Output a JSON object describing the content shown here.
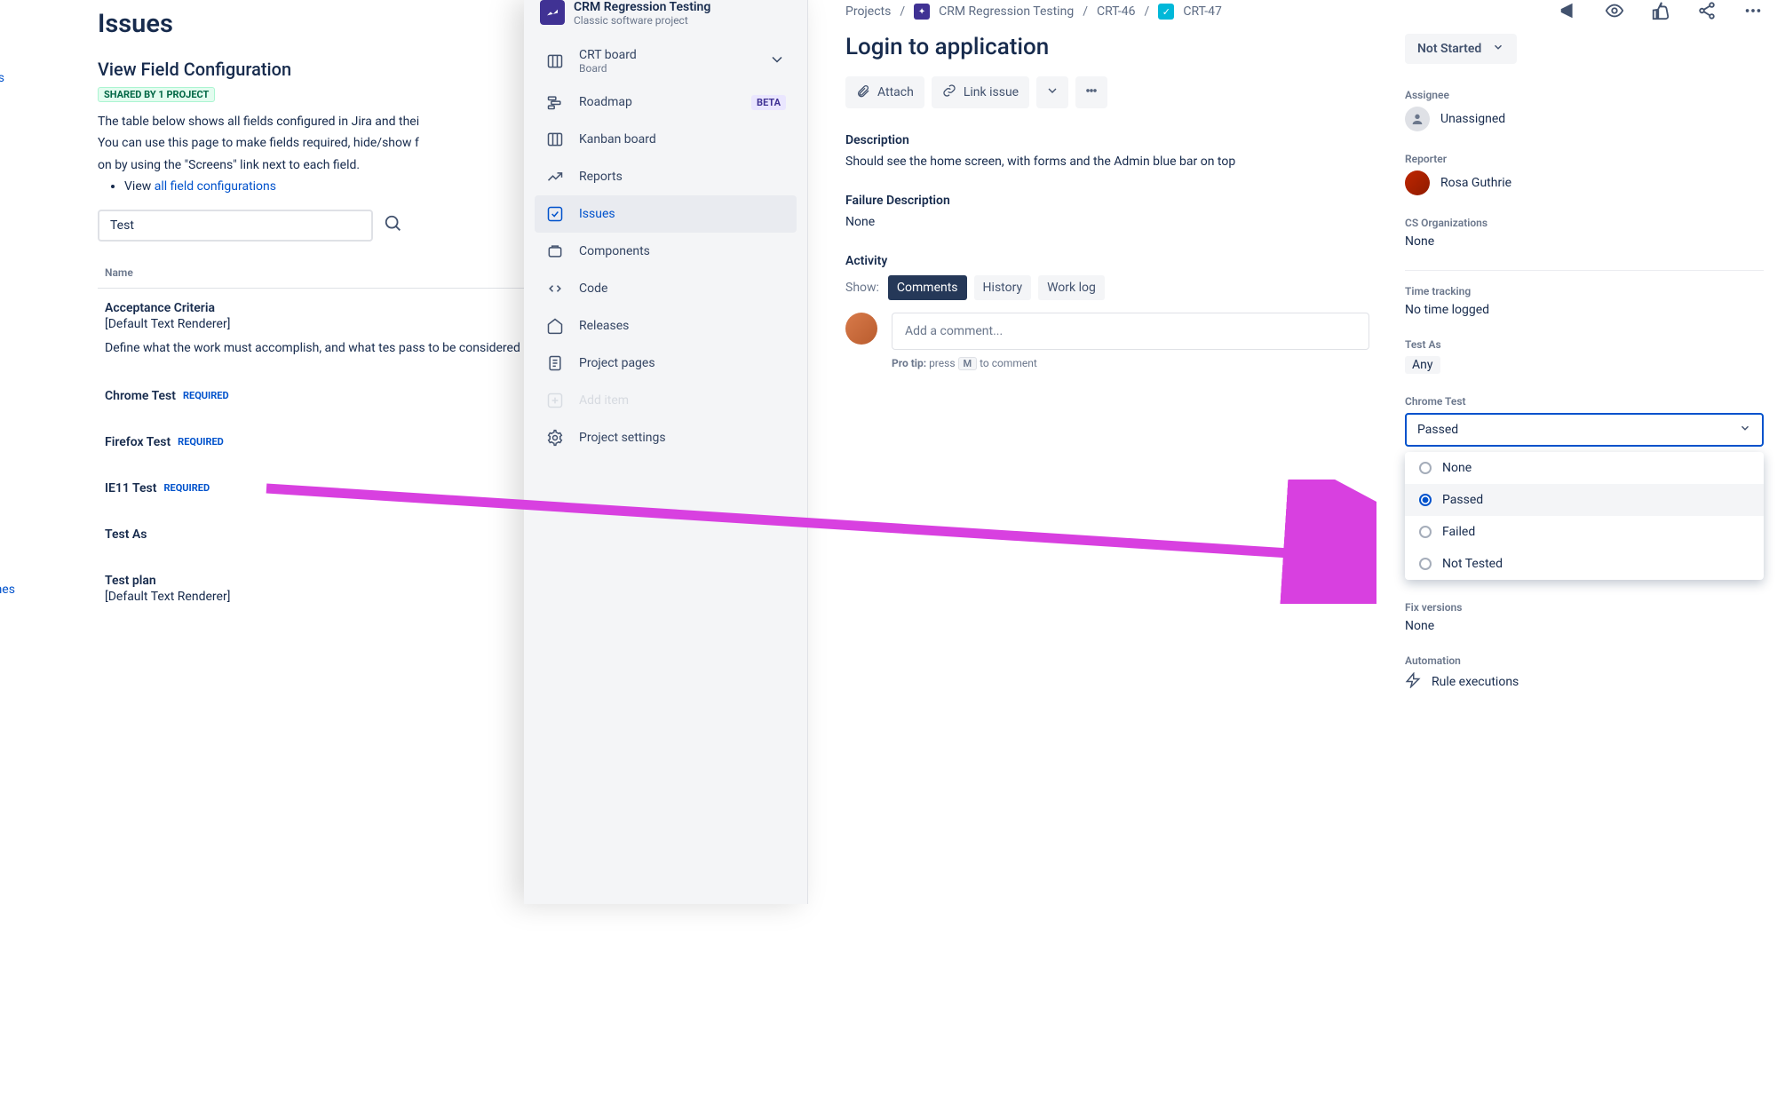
{
  "far_left": {
    "item1": "ns",
    "item2": "mes"
  },
  "left": {
    "heading": "Issues",
    "subheading": "View Field Configuration",
    "shared_badge": "SHARED BY 1 PROJECT",
    "intro1": "The table below shows all fields configured in Jira and thei",
    "intro2": "You can use this page to make fields required, hide/show f",
    "intro3": "on by using the \"Screens\" link next to each field.",
    "view_prefix": "View ",
    "view_link": "all field configurations",
    "search_value": "Test",
    "col_name": "Name",
    "fields": [
      {
        "name": "Acceptance Criteria",
        "renderer": "[Default Text Renderer]",
        "required": false,
        "desc": "Define what the work must accomplish, and what tes pass to be considered complete."
      },
      {
        "name": "Chrome Test",
        "renderer": "",
        "required": true,
        "desc": ""
      },
      {
        "name": "Firefox Test",
        "renderer": "",
        "required": true,
        "desc": ""
      },
      {
        "name": "IE11 Test",
        "renderer": "",
        "required": true,
        "desc": ""
      },
      {
        "name": "Test As",
        "renderer": "",
        "required": false,
        "desc": ""
      },
      {
        "name": "Test plan",
        "renderer": "[Default Text Renderer]",
        "required": false,
        "desc": ""
      }
    ],
    "required_label": "REQUIRED"
  },
  "sidebar": {
    "project_name": "CRM Regression Testing",
    "project_type": "Classic software project",
    "items": [
      {
        "label": "CRT board",
        "sub": "Board",
        "icon": "board",
        "chevron": true
      },
      {
        "label": "Roadmap",
        "icon": "roadmap",
        "badge": "BETA"
      },
      {
        "label": "Kanban board",
        "icon": "kanban"
      },
      {
        "label": "Reports",
        "icon": "reports"
      },
      {
        "label": "Issues",
        "icon": "issues",
        "selected": true
      },
      {
        "label": "Components",
        "icon": "components"
      },
      {
        "label": "Code",
        "icon": "code"
      },
      {
        "label": "Releases",
        "icon": "releases"
      },
      {
        "label": "Project pages",
        "icon": "pages"
      },
      {
        "label": "Add item",
        "icon": "add",
        "dimmed": true
      },
      {
        "label": "Project settings",
        "icon": "settings"
      }
    ]
  },
  "issue": {
    "breadcrumb": {
      "root": "Projects",
      "project": "CRM Regression Testing",
      "parent": "CRT-46",
      "key": "CRT-47"
    },
    "title": "Login to application",
    "buttons": {
      "attach": "Attach",
      "link": "Link issue"
    },
    "description_label": "Description",
    "description_text": "Should see the home screen, with forms and the Admin blue bar on top",
    "failure_label": "Failure Description",
    "failure_text": "None",
    "activity_label": "Activity",
    "show_label": "Show:",
    "tabs": {
      "comments": "Comments",
      "history": "History",
      "worklog": "Work log"
    },
    "comment_placeholder": "Add a comment...",
    "protip_prefix": "Pro tip:",
    "protip_text1": "press",
    "protip_key": "M",
    "protip_text2": "to comment"
  },
  "side": {
    "status": "Not Started",
    "assignee_label": "Assignee",
    "assignee_value": "Unassigned",
    "reporter_label": "Reporter",
    "reporter_value": "Rosa Guthrie",
    "cs_label": "CS Organizations",
    "cs_value": "None",
    "time_label": "Time tracking",
    "time_value": "No time logged",
    "testas_label": "Test As",
    "testas_value": "Any",
    "chrome_label": "Chrome Test",
    "chrome_value": "Passed",
    "chrome_options": [
      "None",
      "Passed",
      "Failed",
      "Not Tested"
    ],
    "chrome_selected_index": 1,
    "fixv_label": "Fix versions",
    "fixv_value": "None",
    "automation_label": "Automation",
    "automation_value": "Rule executions"
  }
}
